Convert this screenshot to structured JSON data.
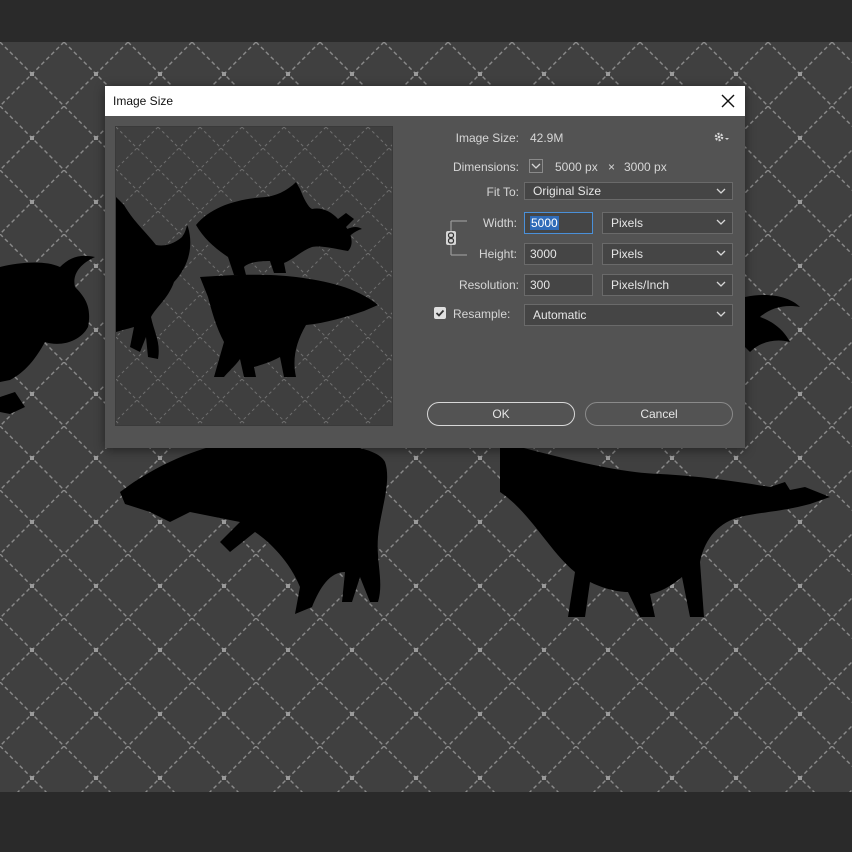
{
  "dialog": {
    "title": "Image Size",
    "image_size_label": "Image Size:",
    "image_size_value": "42.9M",
    "dimensions_label": "Dimensions:",
    "dimensions_width": "5000 px",
    "dimensions_x": "×",
    "dimensions_height": "3000 px",
    "fit_to_label": "Fit To:",
    "fit_to_value": "Original Size",
    "width_label": "Width:",
    "width_value": "5000",
    "width_unit": "Pixels",
    "height_label": "Height:",
    "height_value": "3000",
    "height_unit": "Pixels",
    "resolution_label": "Resolution:",
    "resolution_value": "300",
    "resolution_unit": "Pixels/Inch",
    "resample_label": "Resample:",
    "resample_value": "Automatic",
    "resample_checked": true,
    "ok_label": "OK",
    "cancel_label": "Cancel"
  },
  "colors": {
    "canvas_bg": "#404040",
    "dialog_bg": "#535353",
    "titlebar_bg": "#ffffff",
    "highlight": "#2f6bb8",
    "silhouette": "#000000",
    "pattern_line": "#8a8a8a"
  },
  "icons": {
    "close": "close-icon",
    "gear": "gear-icon",
    "chain_link": "chain-link-icon",
    "checkbox": "checkmark-icon",
    "dropdown": "chevron-down-icon"
  }
}
